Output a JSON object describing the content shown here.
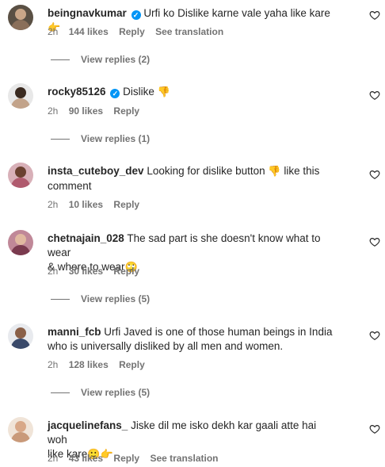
{
  "comments": [
    {
      "username": "beingnavkumar",
      "verified": true,
      "text": "Urfi ko Dislike karne vale yaha like kare",
      "emoji": "👉",
      "time": "2h",
      "likes": "144 likes",
      "reply": "Reply",
      "translate": "See translation",
      "view_replies": "View replies (2)",
      "avatar_color": "#8a6f5a"
    },
    {
      "username": "rocky85126",
      "verified": true,
      "text": "Dislike",
      "emoji": "👎",
      "time": "2h",
      "likes": "90 likes",
      "reply": "Reply",
      "view_replies": "View replies (1)",
      "avatar_color": "#c2a38a"
    },
    {
      "username": "insta_cuteboy_dev",
      "text_line1": "Looking for dislike button",
      "emoji": "👎",
      "text_line1_end": "like this",
      "text_line2": "comment",
      "time": "2h",
      "likes": "10 likes",
      "reply": "Reply",
      "avatar_color": "#b05a6e"
    },
    {
      "username": "chetnajain_028",
      "text_line1": "The sad part is she doesn't know what to wear",
      "text_line2": "& where to wear",
      "emoji": "🙄",
      "time": "2h",
      "likes": "30 likes",
      "reply": "Reply",
      "view_replies": "View replies (5)",
      "avatar_color": "#7a3a4e"
    },
    {
      "username": "manni_fcb",
      "text_line1": "Urfi Javed is one of those human beings in India",
      "text_line2": "who is universally disliked by all men and women.",
      "time": "2h",
      "likes": "128 likes",
      "reply": "Reply",
      "view_replies": "View replies (5)",
      "avatar_color": "#3a4a6a"
    },
    {
      "username": "jacquelinefans_",
      "text_line1": "Jiske dil me isko dekh kar gaali atte hai woh",
      "text_line2": "like kare",
      "emoji": "🙂👉",
      "time": "2h",
      "likes": "43 likes",
      "reply": "Reply",
      "translate": "See translation",
      "avatar_color": "#c99a7a"
    }
  ]
}
